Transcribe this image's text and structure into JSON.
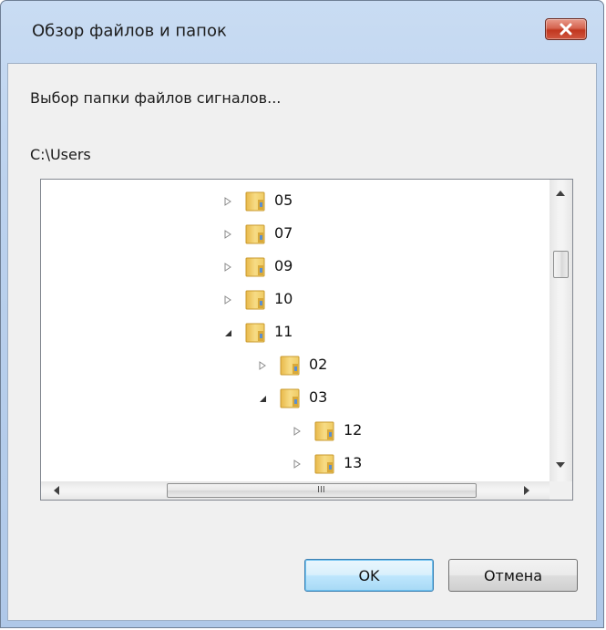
{
  "window": {
    "title": "Обзор файлов и папок",
    "close_icon": "close-icon"
  },
  "dialog": {
    "description": "Выбор папки файлов сигналов...",
    "path": "C:\\Users"
  },
  "tree": {
    "items": [
      {
        "label": "05",
        "expanded": false,
        "level": 0
      },
      {
        "label": "07",
        "expanded": false,
        "level": 0
      },
      {
        "label": "09",
        "expanded": false,
        "level": 0
      },
      {
        "label": "10",
        "expanded": false,
        "level": 0
      },
      {
        "label": "11",
        "expanded": true,
        "level": 0
      },
      {
        "label": "02",
        "expanded": false,
        "level": 1
      },
      {
        "label": "03",
        "expanded": true,
        "level": 1
      },
      {
        "label": "12",
        "expanded": false,
        "level": 2
      },
      {
        "label": "13",
        "expanded": false,
        "level": 2
      }
    ],
    "hscroll_grip": "III"
  },
  "buttons": {
    "ok_label": "OK",
    "cancel_label": "Отмена"
  },
  "colors": {
    "window_frame": "#bcd2ee",
    "close_button": "#c1371f",
    "default_button": "#bee6fd",
    "folder": "#f2c94c"
  }
}
